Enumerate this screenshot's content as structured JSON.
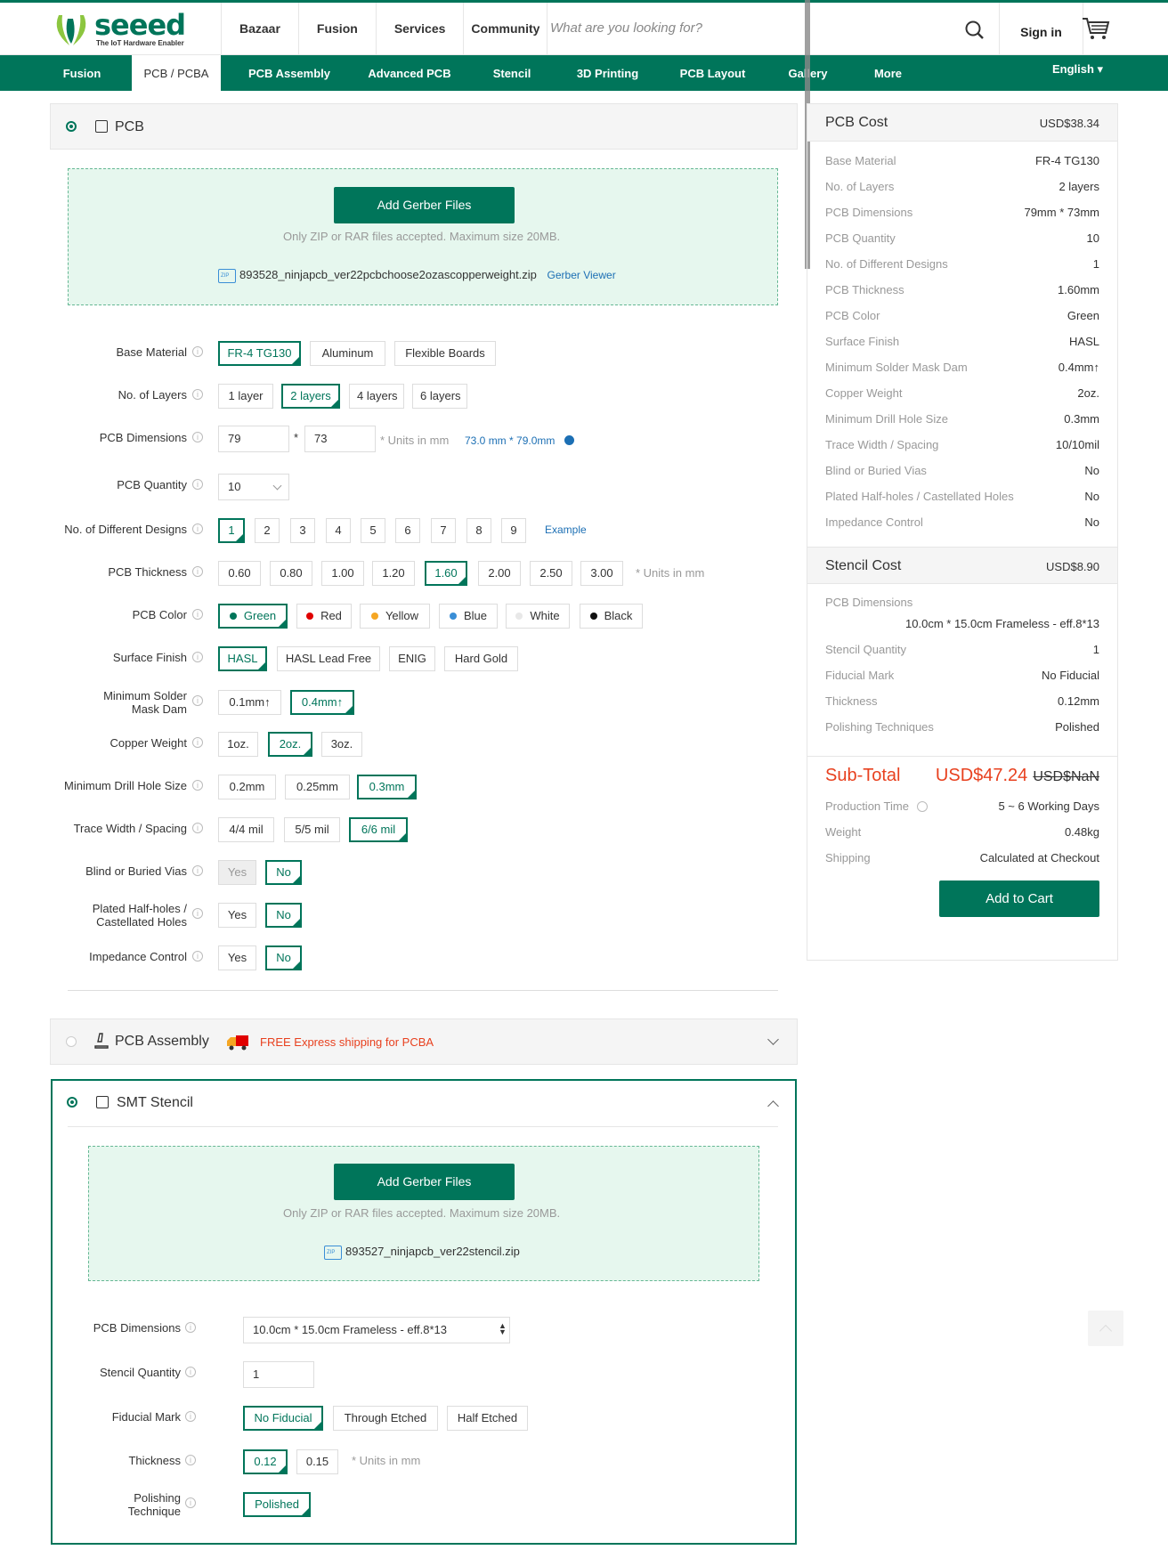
{
  "header": {
    "logo_text": "seeed",
    "logo_tagline": "The IoT Hardware Enabler",
    "nav": [
      "Bazaar",
      "Fusion",
      "Services",
      "Community"
    ],
    "search_placeholder": "What are you looking for?",
    "signin": "Sign in"
  },
  "subnav": {
    "items": [
      "Fusion",
      "PCB / PCBA",
      "PCB Assembly",
      "Advanced PCB",
      "Stencil",
      "3D Printing",
      "PCB Layout",
      "Gallery",
      "More"
    ],
    "active": "PCB / PCBA",
    "language": "English ▾"
  },
  "pcb": {
    "title": "PCB",
    "upload_button": "Add Gerber Files",
    "upload_note": "Only ZIP or RAR files accepted. Maximum size 20MB.",
    "file_name": "893528_ninjapcb_ver22pcbchoose2ozascopperweight.zip",
    "viewer_link": "Gerber Viewer",
    "base_material": {
      "label": "Base Material",
      "options": [
        "FR-4 TG130",
        "Aluminum",
        "Flexible Boards"
      ],
      "selected": "FR-4 TG130"
    },
    "layers": {
      "label": "No. of Layers",
      "options": [
        "1 layer",
        "2 layers",
        "4 layers",
        "6 layers"
      ],
      "selected": "2 layers"
    },
    "dimensions": {
      "label": "PCB Dimensions",
      "width": "79",
      "sep": "*",
      "height": "73",
      "units": "* Units in mm",
      "hint": "73.0 mm * 79.0mm"
    },
    "quantity": {
      "label": "PCB Quantity",
      "value": "10"
    },
    "designs": {
      "label": "No. of Different Designs",
      "options": [
        "1",
        "2",
        "3",
        "4",
        "5",
        "6",
        "7",
        "8",
        "9"
      ],
      "selected": "1",
      "example": "Example"
    },
    "thickness": {
      "label": "PCB Thickness",
      "options": [
        "0.60",
        "0.80",
        "1.00",
        "1.20",
        "1.60",
        "2.00",
        "2.50",
        "3.00"
      ],
      "selected": "1.60",
      "units": "* Units in mm"
    },
    "color": {
      "label": "PCB Color",
      "options": [
        {
          "name": "Green",
          "hex": "#00755a"
        },
        {
          "name": "Red",
          "hex": "#e00000"
        },
        {
          "name": "Yellow",
          "hex": "#f5a623"
        },
        {
          "name": "Blue",
          "hex": "#3a8ed6"
        },
        {
          "name": "White",
          "hex": "#e8e8e8"
        },
        {
          "name": "Black",
          "hex": "#111111"
        }
      ],
      "selected": "Green"
    },
    "finish": {
      "label": "Surface Finish",
      "options": [
        "HASL",
        "HASL Lead Free",
        "ENIG",
        "Hard Gold"
      ],
      "selected": "HASL"
    },
    "mask_dam": {
      "label_line1": "Minimum Solder",
      "label_line2": "Mask Dam",
      "options": [
        "0.1mm↑",
        "0.4mm↑"
      ],
      "selected": "0.4mm↑"
    },
    "copper": {
      "label": "Copper Weight",
      "options": [
        "1oz.",
        "2oz.",
        "3oz."
      ],
      "selected": "2oz."
    },
    "drill": {
      "label": "Minimum Drill Hole Size",
      "options": [
        "0.2mm",
        "0.25mm",
        "0.3mm"
      ],
      "selected": "0.3mm"
    },
    "trace": {
      "label": "Trace Width / Spacing",
      "options": [
        "4/4 mil",
        "5/5 mil",
        "6/6 mil"
      ],
      "selected": "6/6 mil"
    },
    "vias": {
      "label": "Blind or Buried Vias",
      "options": [
        "Yes",
        "No"
      ],
      "selected": "No"
    },
    "halfholes": {
      "label_line1": "Plated Half-holes /",
      "label_line2": "Castellated Holes",
      "options": [
        "Yes",
        "No"
      ],
      "selected": "No"
    },
    "impedance": {
      "label": "Impedance Control",
      "options": [
        "Yes",
        "No"
      ],
      "selected": "No"
    }
  },
  "assembly": {
    "title": "PCB Assembly",
    "promo": "FREE Express shipping for PCBA"
  },
  "stencil": {
    "title": "SMT Stencil",
    "upload_button": "Add Gerber Files",
    "upload_note": "Only ZIP or RAR files accepted. Maximum size 20MB.",
    "file_name": "893527_ninjapcb_ver22stencil.zip",
    "dimensions": {
      "label": "PCB Dimensions",
      "value": "10.0cm * 15.0cm Frameless - eff.8*13"
    },
    "quantity": {
      "label": "Stencil Quantity",
      "value": "1"
    },
    "fiducial": {
      "label": "Fiducial Mark",
      "options": [
        "No Fiducial",
        "Through Etched",
        "Half Etched"
      ],
      "selected": "No Fiducial"
    },
    "thickness": {
      "label": "Thickness",
      "options": [
        "0.12",
        "0.15"
      ],
      "selected": "0.12",
      "units": "* Units in mm"
    },
    "polishing": {
      "label_line1": "Polishing",
      "label_line2": "Technique",
      "options": [
        "Polished"
      ],
      "selected": "Polished"
    }
  },
  "summary": {
    "pcb_cost_label": "PCB Cost",
    "pcb_cost": "USD$38.34",
    "pcb_rows": [
      {
        "k": "Base Material",
        "v": "FR-4 TG130"
      },
      {
        "k": "No. of Layers",
        "v": "2 layers"
      },
      {
        "k": "PCB Dimensions",
        "v": "79mm * 73mm"
      },
      {
        "k": "PCB Quantity",
        "v": "10"
      },
      {
        "k": "No. of Different Designs",
        "v": "1"
      },
      {
        "k": "PCB Thickness",
        "v": "1.60mm"
      },
      {
        "k": "PCB Color",
        "v": "Green"
      },
      {
        "k": "Surface Finish",
        "v": "HASL"
      },
      {
        "k": "Minimum Solder Mask Dam",
        "v": "0.4mm↑"
      },
      {
        "k": "Copper Weight",
        "v": "2oz."
      },
      {
        "k": "Minimum Drill Hole Size",
        "v": "0.3mm"
      },
      {
        "k": "Trace Width / Spacing",
        "v": "10/10mil"
      },
      {
        "k": "Blind or Buried Vias",
        "v": "No"
      },
      {
        "k": "Plated Half-holes / Castellated Holes",
        "v": "No"
      },
      {
        "k": "Impedance Control",
        "v": "No"
      }
    ],
    "stencil_cost_label": "Stencil Cost",
    "stencil_cost": "USD$8.90",
    "stencil_dim_label": "PCB Dimensions",
    "stencil_dim_value": "10.0cm * 15.0cm Frameless - eff.8*13",
    "stencil_rows": [
      {
        "k": "Stencil Quantity",
        "v": "1"
      },
      {
        "k": "Fiducial Mark",
        "v": "No Fiducial"
      },
      {
        "k": "Thickness",
        "v": "0.12mm"
      },
      {
        "k": "Polishing Techniques",
        "v": "Polished"
      }
    ],
    "subtotal_label": "Sub-Total",
    "subtotal": "USD$47.24",
    "subtotal_old": "USD$NaN",
    "bottom_rows": [
      {
        "k": "Production Time",
        "v": "5 ~ 6 Working Days"
      },
      {
        "k": "Weight",
        "v": "0.48kg"
      },
      {
        "k": "Shipping",
        "v": "Calculated at Checkout"
      }
    ],
    "add_to_cart": "Add to Cart"
  }
}
